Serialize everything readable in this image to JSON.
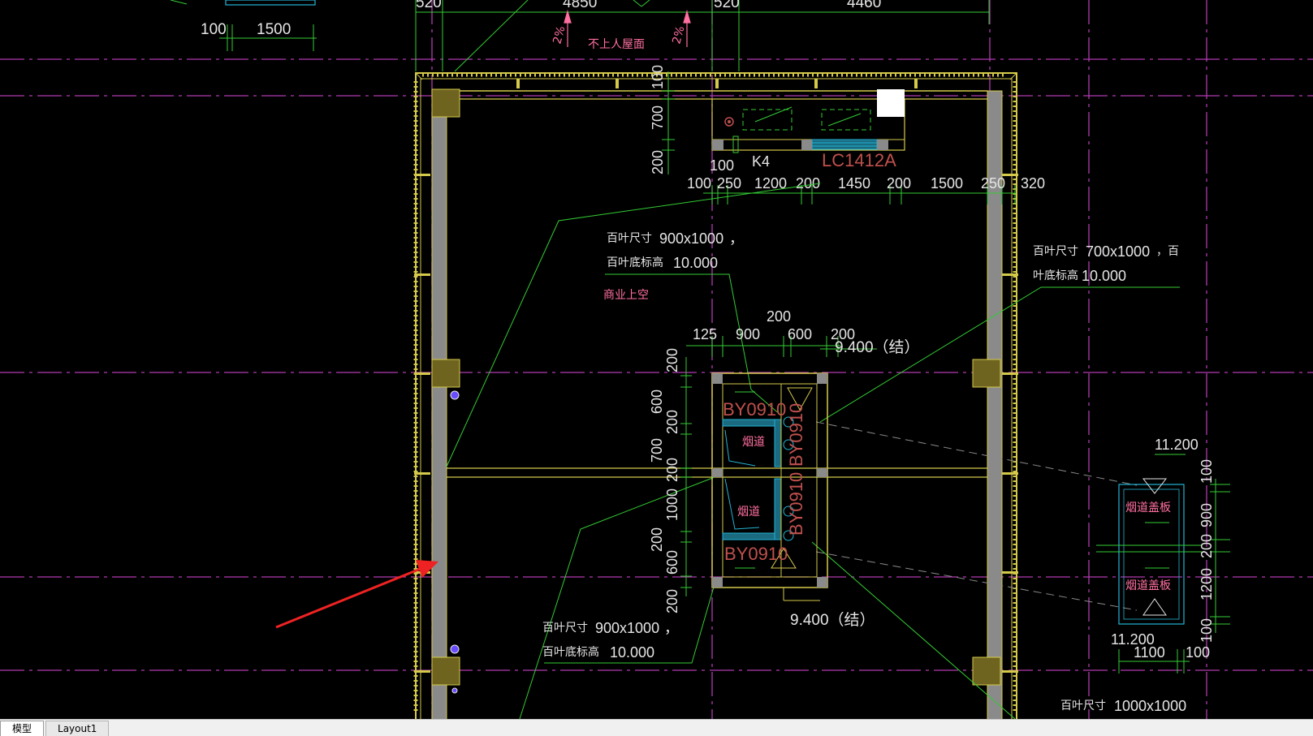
{
  "tabs": [
    {
      "label": "模型",
      "active": true
    },
    {
      "label": "Layout1",
      "active": false
    }
  ],
  "drawing": {
    "top_dims": [
      "520",
      "4850",
      "520",
      "4460"
    ],
    "top_left_dims": [
      "100",
      "1500"
    ],
    "slope_left": "2%",
    "slope_right": "2%",
    "roof_note": "不上人屋面",
    "vert_dims_top": [
      "100",
      "700",
      "200"
    ],
    "door_tag": "K4",
    "window_tag": "LC1412A",
    "dim_100": "100",
    "horizontal_dims": [
      "100",
      "250",
      "1200",
      "200",
      "1450",
      "200",
      "1500",
      "250",
      "320"
    ],
    "louver_1_size_label": "百叶尺寸",
    "louver_1_size": "900x1000",
    "louver_1_comma": "，",
    "louver_1_elev_label": "百叶底标高",
    "louver_1_elev": "10.000",
    "commercial_void": "商业上空",
    "louver_2_size_label": "百叶尺寸",
    "louver_2_size": "700x1000",
    "louver_2_tail": "，百",
    "louver_2_elev_label": "叶底标高",
    "louver_2_elev": "10.000",
    "shaft_dim_top": "200",
    "shaft_dims": [
      "125",
      "900",
      "600",
      "200"
    ],
    "elev_top": "9.400（结）",
    "shaft_vert_dims": [
      "200",
      "600",
      "200",
      "700",
      "200",
      "1000",
      "200",
      "600",
      "200"
    ],
    "tag_by0910_a": "BY0910",
    "tag_by0910_b": "BY0910",
    "tag_by0910_c": "BY0910",
    "tag_by0910_d": "BY0910",
    "flue_a": "烟道",
    "flue_b": "烟道",
    "elev_bottom": "9.400（结）",
    "louver_3_size_label": "百叶尺寸",
    "louver_3_size": "900x1000",
    "louver_3_comma": "，",
    "louver_3_elev_label": "百叶底标高",
    "louver_3_elev": "10.000",
    "detail_elev_top": "11.200",
    "detail_cover_top": "烟道盖板",
    "detail_cover_bottom": "烟道盖板",
    "detail_vert_dims": [
      "100",
      "900",
      "200",
      "1200",
      "100"
    ],
    "detail_elev_bottom": "11.200",
    "detail_bottom_dims": [
      "1100",
      "100"
    ],
    "louver_4_size_label": "百叶尺寸",
    "louver_4_size": "1000x1000"
  },
  "colors": {
    "background": "#000000",
    "wall_yellow": "#d4c94a",
    "dim_green": "#33cc33",
    "grid_magenta": "#b03bb0",
    "text_white": "#e6e6e6",
    "tag_red": "#c0504d",
    "arrow_red": "#ee2222",
    "column_gray": "#8a8a8a",
    "hatch_yellow": "#9a8a2a",
    "cyan": "#22b4d4"
  }
}
